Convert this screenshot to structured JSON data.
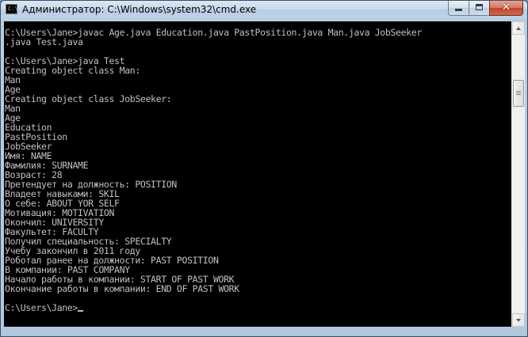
{
  "window": {
    "title": "Администратор: C:\\Windows\\system32\\cmd.exe",
    "app_icon_text": "C:\\",
    "close_glyph": "✕"
  },
  "console": {
    "lines": [
      "C:\\Users\\Jane>javac Age.java Education.java PastPosition.java Man.java JobSeeker",
      ".java Test.java",
      "",
      "C:\\Users\\Jane>java Test",
      "Creating object class Man:",
      "Man",
      "Age",
      "Creating object class JobSeeker:",
      "Man",
      "Age",
      "Education",
      "PastPosition",
      "JobSeeker",
      "Имя: NAME",
      "Фамилия: SURNAME",
      "Возраст: 28",
      "Претендует на должность: POSITION",
      "Владеет навыками: SKIL",
      "О себе: ABOUT YOR SELF",
      "Мотивация: MOTIVATION",
      "Окончил: UNIVERSITY",
      "Факультет: FACULTY",
      "Получил специальность: SPECIALTY",
      "Учебу закончил в 2011 году",
      "Роботал ранее на должности: PAST POSITION",
      "В компании: PAST COMPANY",
      "Начало работы в компании: START OF PAST WORK",
      "Окончание работы в компании: END OF PAST WORK",
      "",
      "C:\\Users\\Jane>"
    ]
  },
  "colors": {
    "console_bg": "#000000",
    "console_fg": "#c0c0c0",
    "close_button": "#c1452a"
  }
}
